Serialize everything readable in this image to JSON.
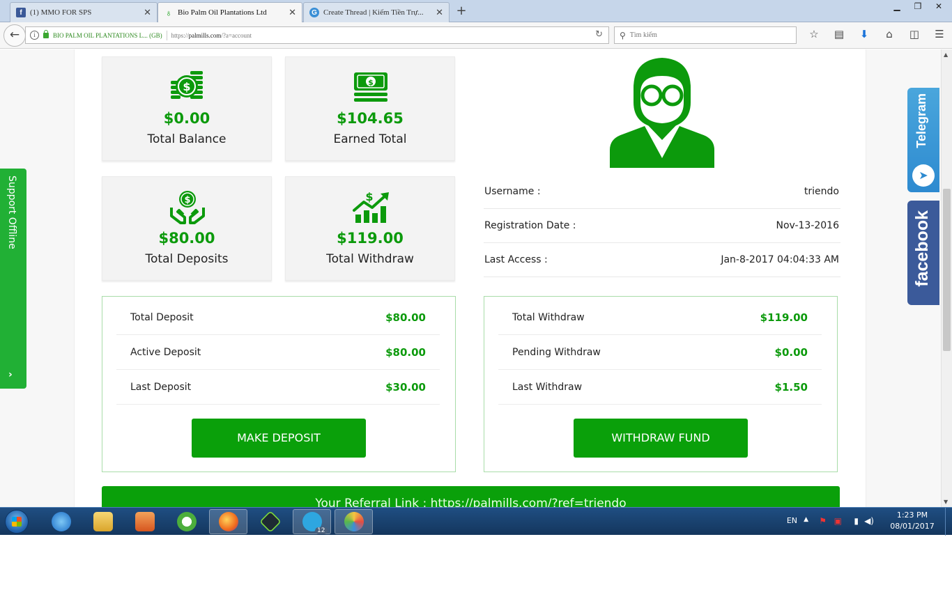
{
  "browser": {
    "tabs": [
      {
        "title": "(1) MMO FOR SPS",
        "favicon": "facebook-icon"
      },
      {
        "title": "Bio Palm Oil Plantations Ltd",
        "favicon": "palm-leaf-icon"
      },
      {
        "title": "Create Thread | Kiếm Tiền Trự...",
        "favicon": "globe-icon"
      }
    ],
    "site_identity": "BIO PALM OIL PLANTATIONS L... (GB)",
    "url_prefix": "https://",
    "url_host": "palmills.com",
    "url_path": "/?a=account",
    "search_placeholder": "Tìm kiếm"
  },
  "stats": {
    "total_balance": {
      "amount": "$0.00",
      "label": "Total Balance"
    },
    "earned_total": {
      "amount": "$104.65",
      "label": "Earned Total"
    },
    "total_deposits": {
      "amount": "$80.00",
      "label": "Total Deposits"
    },
    "total_withdraw": {
      "amount": "$119.00",
      "label": "Total Withdraw"
    }
  },
  "account": {
    "username_label": "Username :",
    "username": "triendo",
    "registration_label": "Registration Date :",
    "registration_date": "Nov-13-2016",
    "last_access_label": "Last Access :",
    "last_access": "Jan-8-2017 04:04:33 AM"
  },
  "deposit_summary": {
    "rows": [
      {
        "label": "Total Deposit",
        "value": "$80.00"
      },
      {
        "label": "Active Deposit",
        "value": "$80.00"
      },
      {
        "label": "Last Deposit",
        "value": "$30.00"
      }
    ],
    "button": "MAKE DEPOSIT"
  },
  "withdraw_summary": {
    "rows": [
      {
        "label": "Total Withdraw",
        "value": "$119.00"
      },
      {
        "label": "Pending Withdraw",
        "value": "$0.00"
      },
      {
        "label": "Last Withdraw",
        "value": "$1.50"
      }
    ],
    "button": "WITHDRAW FUND"
  },
  "referral": "Your Referral Link : https://palmills.com/?ref=triendo",
  "side_widgets": {
    "support": "Support Offline",
    "telegram": "Telegram",
    "facebook": "facebook"
  },
  "taskbar": {
    "language": "EN",
    "time": "1:23 PM",
    "date": "08/01/2017",
    "telegram_badge": "12"
  },
  "colors": {
    "brand_green": "#0aa00a",
    "amount_green": "#0c9a0c",
    "telegram_blue": "#2d8ad0",
    "facebook_blue": "#3b5a9a"
  }
}
